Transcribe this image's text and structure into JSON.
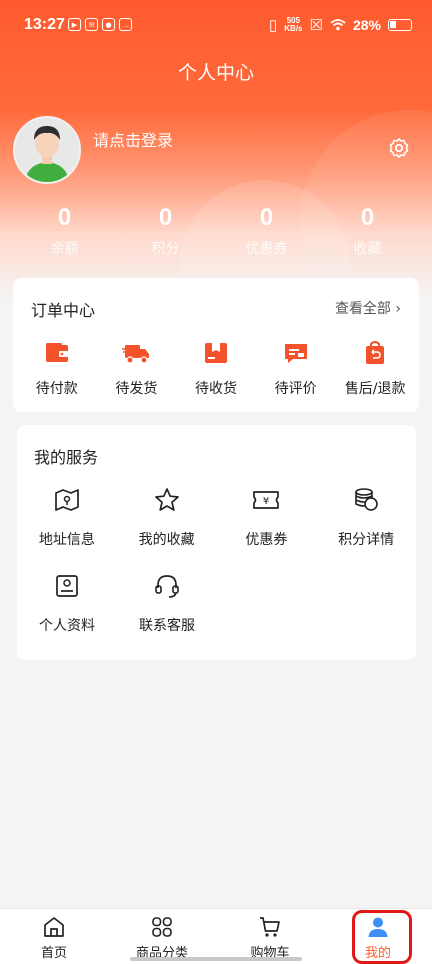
{
  "status_bar": {
    "time": "13:27",
    "speed_top": "505",
    "speed_bottom": "KB/s",
    "battery": "28%"
  },
  "header": {
    "title": "个人中心"
  },
  "profile": {
    "login_prompt": "请点击登录"
  },
  "stats": [
    {
      "value": "0",
      "label": "余额"
    },
    {
      "value": "0",
      "label": "积分"
    },
    {
      "value": "0",
      "label": "优惠券"
    },
    {
      "value": "0",
      "label": "收藏"
    }
  ],
  "orders": {
    "title": "订单中心",
    "view_all": "查看全部",
    "items": [
      {
        "label": "待付款",
        "icon": "wallet-icon"
      },
      {
        "label": "待发货",
        "icon": "truck-icon"
      },
      {
        "label": "待收货",
        "icon": "box-icon"
      },
      {
        "label": "待评价",
        "icon": "comment-icon"
      },
      {
        "label": "售后/退款",
        "icon": "refund-bag-icon"
      }
    ]
  },
  "services": {
    "title": "我的服务",
    "items": [
      {
        "label": "地址信息",
        "icon": "map-icon"
      },
      {
        "label": "我的收藏",
        "icon": "star-icon"
      },
      {
        "label": "优惠券",
        "icon": "coupon-icon"
      },
      {
        "label": "积分详情",
        "icon": "coins-icon"
      },
      {
        "label": "个人资料",
        "icon": "profile-card-icon"
      },
      {
        "label": "联系客服",
        "icon": "headset-icon"
      }
    ]
  },
  "tabbar": [
    {
      "label": "首页",
      "icon": "home-icon"
    },
    {
      "label": "商品分类",
      "icon": "category-icon"
    },
    {
      "label": "购物车",
      "icon": "cart-icon"
    },
    {
      "label": "我的",
      "icon": "user-icon",
      "active": true
    }
  ],
  "colors": {
    "accent": "#ff5a2e",
    "highlight": "#e01818",
    "user_icon": "#3d8ff5"
  }
}
